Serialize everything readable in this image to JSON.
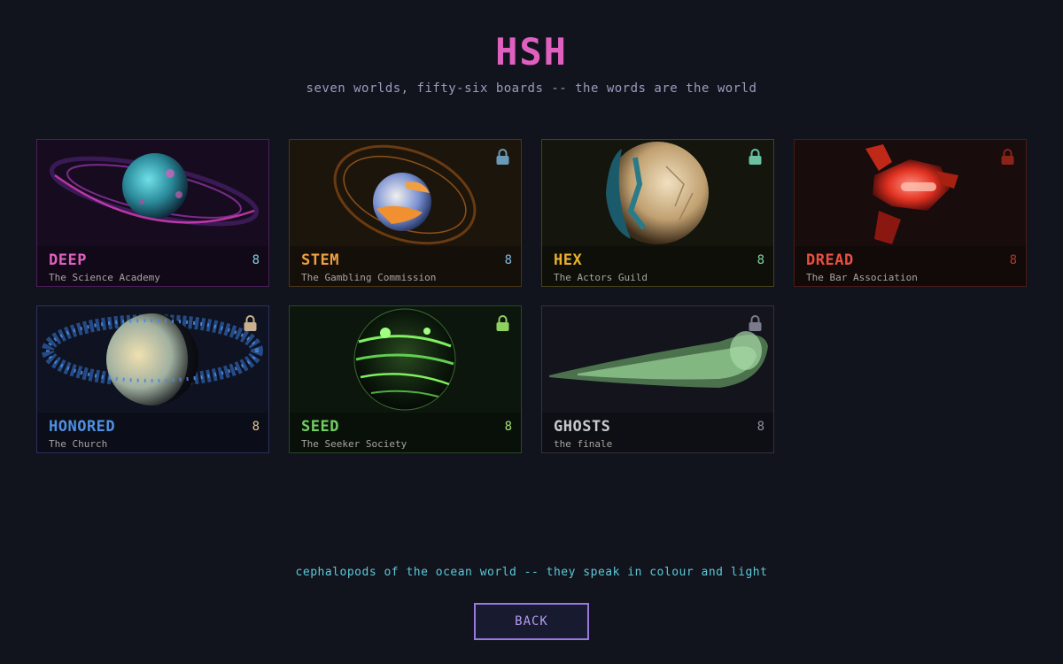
{
  "header": {
    "title": "HSH",
    "subtitle": "seven worlds, fifty-six boards -- the words are the world"
  },
  "worlds": [
    {
      "name": "DEEP",
      "org": "The Science Academy",
      "count": "8",
      "locked": false,
      "accent": "#e060c0",
      "count_color": "#7fd0e0",
      "bg": "#170c1f",
      "border": "#4a1f5a",
      "icon": "ringed-ocean-planet-icon"
    },
    {
      "name": "STEM",
      "org": "The Gambling Commission",
      "count": "8",
      "locked": true,
      "accent": "#f0a040",
      "count_color": "#7fb8e0",
      "bg": "#1c150c",
      "border": "#4a3518",
      "icon": "orange-ringed-planet-icon"
    },
    {
      "name": "HEX",
      "org": "The Actors Guild",
      "count": "8",
      "locked": true,
      "accent": "#e8b030",
      "count_color": "#7fd0a0",
      "bg": "#14150c",
      "border": "#4a4218",
      "icon": "cracked-desert-planet-icon"
    },
    {
      "name": "DREAD",
      "org": "The Bar Association",
      "count": "8",
      "locked": true,
      "accent": "#e85040",
      "count_color": "#b03a2a",
      "bg": "#180c0c",
      "border": "#4a1c18",
      "icon": "red-crystal-cluster-icon"
    },
    {
      "name": "HONORED",
      "org": "The Church",
      "count": "8",
      "locked": true,
      "accent": "#5090e0",
      "count_color": "#e0c890",
      "bg": "#0f1220",
      "border": "#2a3060",
      "icon": "debris-ring-planet-icon"
    },
    {
      "name": "SEED",
      "org": "The Seeker Society",
      "count": "8",
      "locked": true,
      "accent": "#70d060",
      "count_color": "#a0e070",
      "bg": "#0c160c",
      "border": "#254a25",
      "icon": "green-energy-planet-icon"
    },
    {
      "name": "GHOSTS",
      "org": "the finale",
      "count": "8",
      "locked": true,
      "accent": "#c8c8d0",
      "count_color": "#9090a0",
      "bg": "#13141c",
      "border": "#30323f",
      "icon": "green-ghost-comet-icon"
    }
  ],
  "footer": {
    "tagline": "cephalopods of the ocean world -- they speak in colour and light",
    "back_label": "BACK"
  }
}
